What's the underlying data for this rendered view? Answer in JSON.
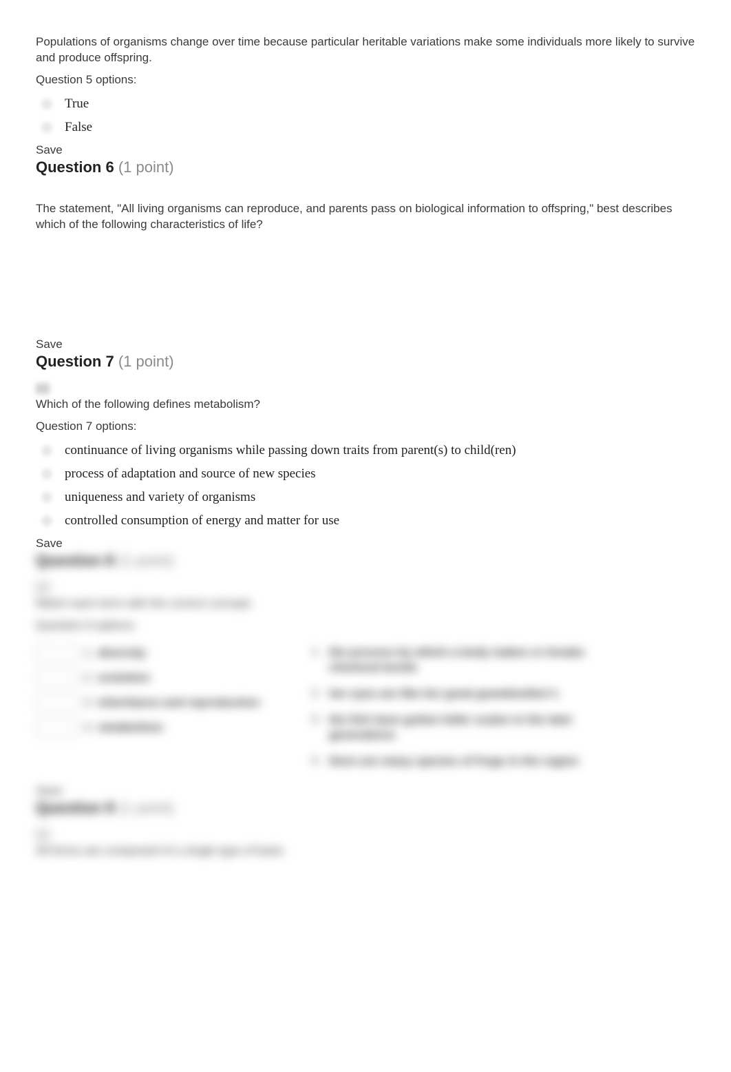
{
  "q5": {
    "prompt": "Populations of organisms change over time because particular heritable variations make some individuals more likely to survive and produce offspring.",
    "options_label": "Question 5 options:",
    "opt_true": "True",
    "opt_false": "False",
    "save": "Save"
  },
  "q6": {
    "label": "Question 6",
    "points": "(1 point)",
    "prompt": "The statement, \"All living organisms can reproduce, and parents pass on biological information to offspring,\" best describes which of the following characteristics of life?",
    "save": "Save"
  },
  "q7": {
    "label": "Question 7",
    "points": "(1 point)",
    "prompt": "Which of the following defines metabolism?",
    "options_label": "Question 7 options:",
    "opt_a": "continuance of living organisms while passing down traits from parent(s) to child(ren)",
    "opt_b": "process of adaptation and source of new species",
    "opt_c": "uniqueness and variety of organisms",
    "opt_d": "controlled consumption of energy and matter for use",
    "save": "Save"
  },
  "q8": {
    "label": "Question 8",
    "points": "(1 point)",
    "prompt": "Match each term with the correct concept.",
    "options_label": "Question 8 options:",
    "terms": {
      "t1_num": "1.",
      "t1": "diversity",
      "t2_num": "2.",
      "t2": "evolution",
      "t3_num": "3.",
      "t3": "inheritance and reproduction",
      "t4_num": "4.",
      "t4": "metabolism"
    },
    "defs": {
      "d1_num": "1.",
      "d1": "the process by which a body makes or breaks chemical bonds",
      "d2_num": "2.",
      "d2": "her eyes are like her great grandmother's",
      "d3_num": "3.",
      "d3": "the fish have gotten fuller scales in the later generations",
      "d4_num": "4.",
      "d4": "there are many species of frogs in the region"
    },
    "save": "Save"
  },
  "q9": {
    "label": "Question 9",
    "points": "(1 point)",
    "prompt": "All forms are composed of a single type of basic"
  }
}
